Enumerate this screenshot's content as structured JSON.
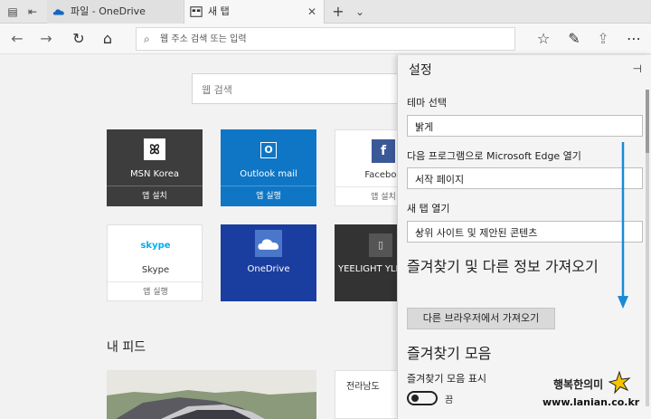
{
  "tabs": {
    "onedrive_label": "파일 - OneDrive",
    "active_label": "새 탭"
  },
  "address_bar": {
    "placeholder": "웹 주소 검색 또는 입력"
  },
  "main": {
    "search_placeholder": "웹 검색",
    "tiles": [
      {
        "name": "MSN Korea",
        "action": "앱 설치"
      },
      {
        "name": "Outlook mail",
        "action": "앱 실행"
      },
      {
        "name": "Faceboo",
        "action": "앱 설치"
      },
      {
        "name": "Skype",
        "action": "앱 실행"
      },
      {
        "name": "OneDrive",
        "action": ""
      },
      {
        "name": "YEELIGHT YLD",
        "action": ""
      }
    ],
    "feed_title": "내 피드",
    "news_card_region": "전라남도"
  },
  "settings": {
    "title": "설정",
    "theme_label": "테마 선택",
    "theme_value": "밝게",
    "open_with_label": "다음 프로그램으로 Microsoft Edge 열기",
    "open_with_value": "시작 페이지",
    "new_tab_label": "새 탭 열기",
    "new_tab_value": "상위 사이트 및 제안된 콘텐츠",
    "import_heading": "즐겨찾기 및 다른 정보 가져오기",
    "import_button": "다른 브라우저에서 가져오기",
    "favbar_heading": "즐겨찾기 모음",
    "favbar_show_label": "즐겨찾기 모음 표시",
    "favbar_toggle_state": "끔"
  },
  "watermark": {
    "line1": "행복한의미",
    "line2": "www.lanian.co.kr"
  },
  "colors": {
    "accent_arrow": "#1a8ad4",
    "outlook_tile": "#0f76c5",
    "onedrive_tile": "#1a3ea0"
  }
}
